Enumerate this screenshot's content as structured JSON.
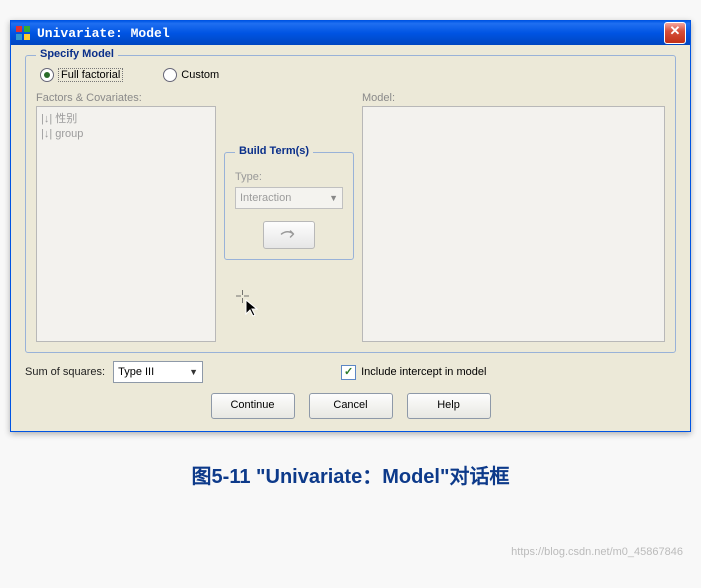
{
  "window": {
    "title": "Univariate: Model"
  },
  "specify_model": {
    "legend": "Specify Model",
    "options": {
      "full_factorial": "Full factorial",
      "custom": "Custom"
    },
    "selected": "full_factorial"
  },
  "factors": {
    "label": "Factors & Covariates:",
    "items": [
      "性别",
      "group"
    ]
  },
  "model": {
    "label": "Model:"
  },
  "build_terms": {
    "legend": "Build Term(s)",
    "type_label": "Type:",
    "type_value": "Interaction"
  },
  "sum_of_squares": {
    "label": "Sum of squares:",
    "value": "Type III"
  },
  "intercept": {
    "label": "Include intercept in model",
    "checked": true
  },
  "buttons": {
    "continue": "Continue",
    "cancel": "Cancel",
    "help": "Help"
  },
  "caption": "图5-11 \"Univariate：Model\"对话框",
  "watermark": "https://blog.csdn.net/m0_45867846"
}
